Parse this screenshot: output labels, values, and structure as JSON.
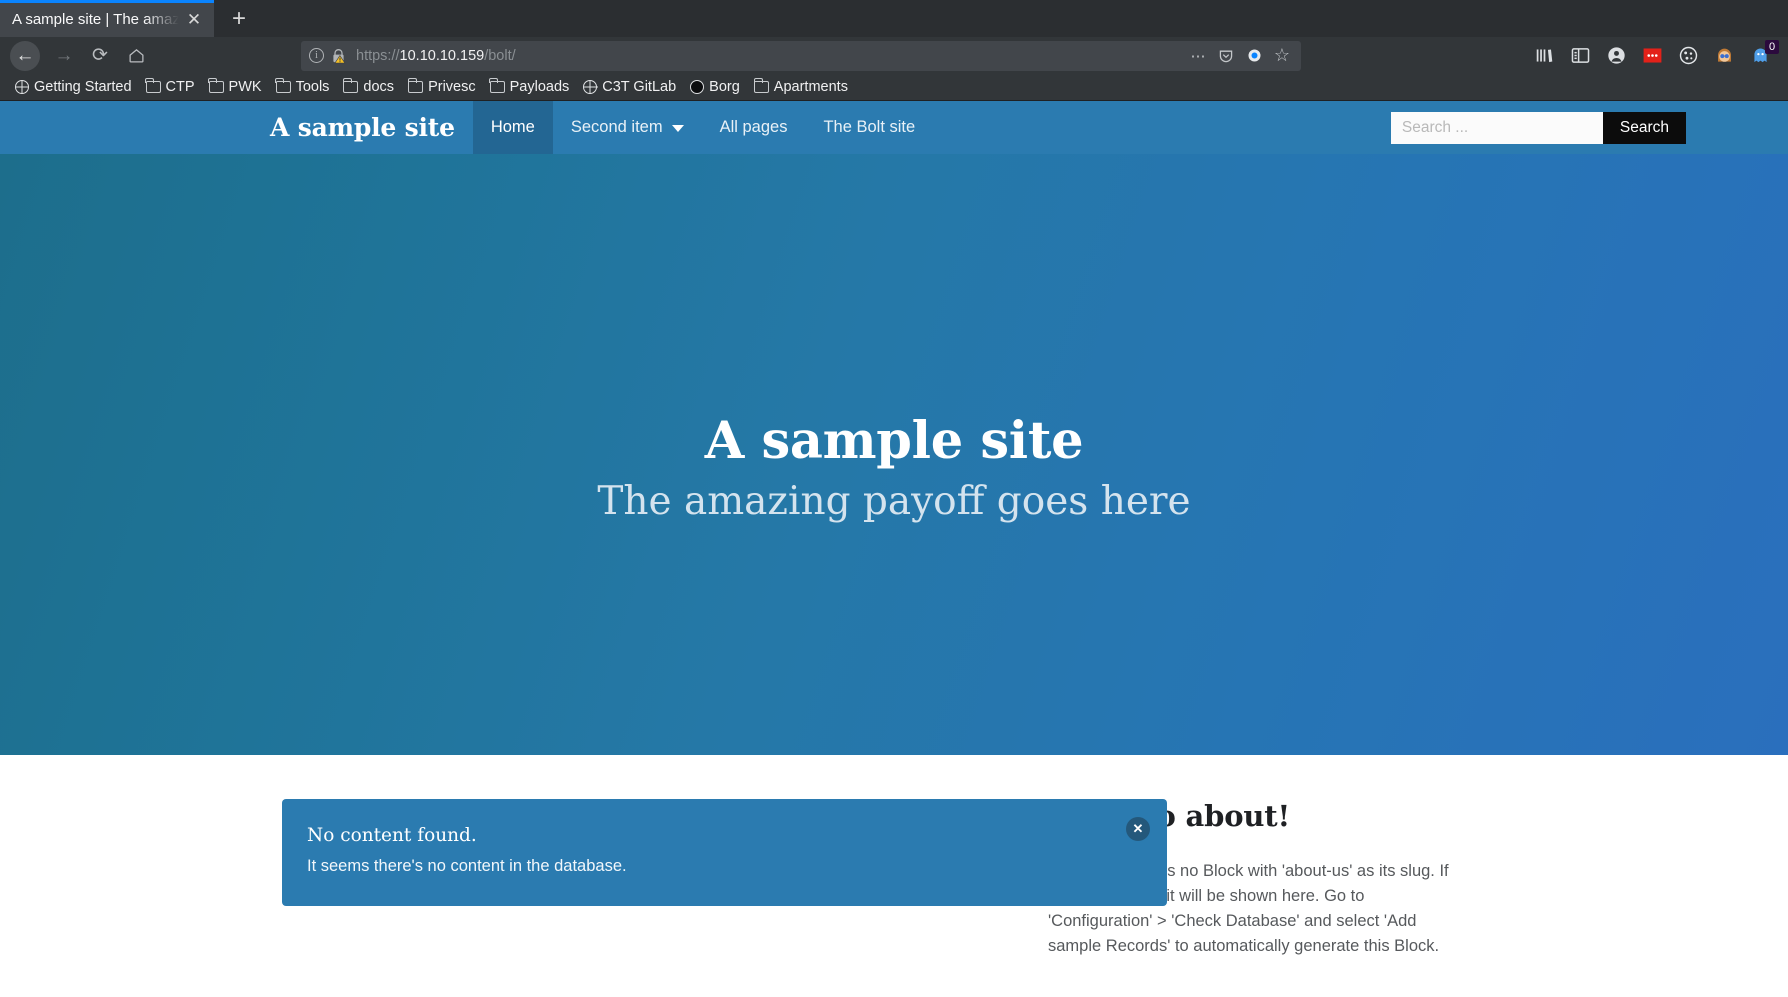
{
  "browser": {
    "tab": {
      "title": "A sample site | The amazing",
      "close_label": "✕"
    },
    "newtab_label": "+",
    "nav": {
      "back": "←",
      "forward": "→",
      "reload": "⟳",
      "home": "⌂"
    },
    "url": {
      "scheme": "https://",
      "host": "10.10.10.159",
      "path": "/bolt/",
      "info_icon": "i",
      "lock_warning_icon": "lock-warning-icon",
      "ellipsis": "⋯",
      "pocket_icon": "pocket-icon",
      "reader_icon": "reader-icon",
      "bookmark_star_icon": "☆"
    },
    "toolbar_icons": [
      "library-icon",
      "sidebar-icon",
      "account-icon",
      "red-extension-icon",
      "cookie-icon",
      "person-extension-icon",
      "ghost-extension-icon"
    ],
    "ghost_badge": "0",
    "bookmarks": [
      {
        "label": "Getting Started",
        "icon": "globe-icon"
      },
      {
        "label": "CTP",
        "icon": "folder-icon"
      },
      {
        "label": "PWK",
        "icon": "folder-icon"
      },
      {
        "label": "Tools",
        "icon": "folder-icon"
      },
      {
        "label": "docs",
        "icon": "folder-icon"
      },
      {
        "label": "Privesc",
        "icon": "folder-icon"
      },
      {
        "label": "Payloads",
        "icon": "folder-icon"
      },
      {
        "label": "C3T GitLab",
        "icon": "globe-icon"
      },
      {
        "label": "Borg",
        "icon": "borg-icon"
      },
      {
        "label": "Apartments",
        "icon": "folder-icon"
      }
    ]
  },
  "site": {
    "brand": "A sample site",
    "nav_items": [
      {
        "label": "Home",
        "active": true,
        "has_caret": false
      },
      {
        "label": "Second item",
        "active": false,
        "has_caret": true
      },
      {
        "label": "All pages",
        "active": false,
        "has_caret": false
      },
      {
        "label": "The Bolt site",
        "active": false,
        "has_caret": false
      }
    ],
    "search": {
      "placeholder": "Search ...",
      "value": "",
      "button_label": "Search"
    },
    "hero": {
      "title": "A sample site",
      "subtitle": "The amazing payoff goes here"
    },
    "alert": {
      "title": "No content found.",
      "text": "It seems there's no content in the database.",
      "close_label": "✕"
    },
    "sidebar": {
      "title": "Alas, no about!",
      "text": "There currently is no Block with 'about-us' as its slug. If you create one, it will be shown here. Go to 'Configuration' > 'Check Database' and select 'Add sample Records' to automatically generate this Block."
    }
  },
  "colors": {
    "nav_blue": "#2b7bb0",
    "nav_active_blue": "#236693",
    "hero_left": "#1d6e8c",
    "hero_right": "#2a6fbd",
    "search_btn": "#0c0c0c",
    "chrome_bg": "#323639",
    "tab_active": "#42464b",
    "tab_accent": "#0a84ff"
  }
}
